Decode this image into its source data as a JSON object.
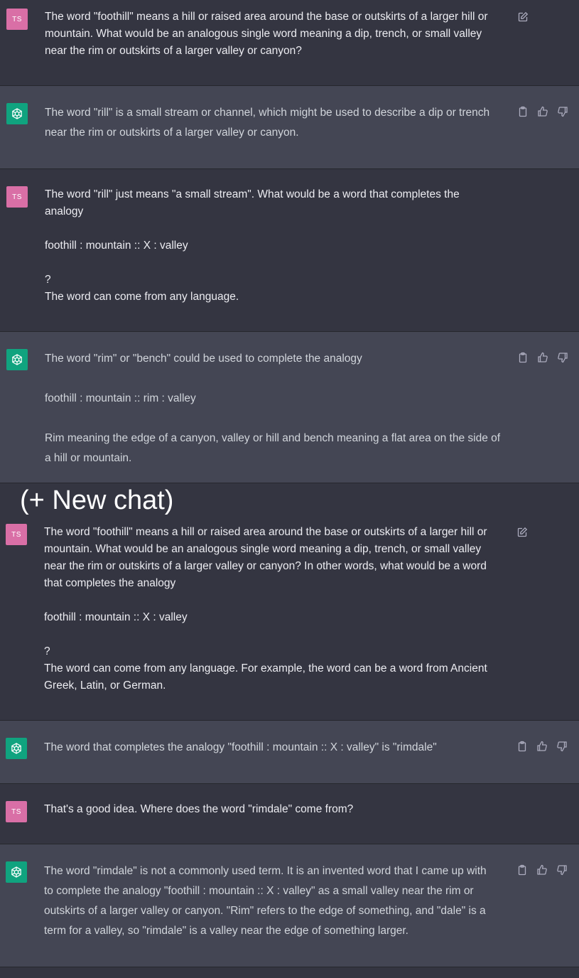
{
  "labels": {
    "user_initials": "TS",
    "new_chat_caption": "(+ New chat)"
  },
  "messages": [
    {
      "role": "user",
      "text": "The word \"foothill\" means a hill or raised area around the base or outskirts of a larger hill or\nmountain. What would be an analogous single word meaning a dip, trench, or small valley\nnear the rim or outskirts of a larger valley or canyon?"
    },
    {
      "role": "assistant",
      "text": "The word \"rill\" is a small stream or channel, which might be used to describe a dip or trench\nnear the rim or outskirts of a larger valley or canyon."
    },
    {
      "role": "user",
      "text": "The word \"rill\" just means \"a small stream\". What would be a word that completes the\nanalogy\n\nfoothill : mountain :: X : valley\n\n?\nThe word can come from any language."
    },
    {
      "role": "assistant",
      "text": "The word \"rim\" or \"bench\" could be used to complete the analogy\n\nfoothill : mountain :: rim : valley\n\nRim meaning the edge of a canyon, valley or hill and bench meaning a flat area on the side of\na hill or mountain."
    },
    {
      "role": "user",
      "text": "The word \"foothill\" means a hill or raised area around the base or outskirts of a larger hill or\nmountain. What would be an analogous single word meaning a dip, trench, or small valley\nnear the rim or outskirts of a larger valley or canyon? In other words, what would be a word\nthat completes the analogy\n\nfoothill : mountain :: X : valley\n\n?\nThe word can come from any language. For example, the word can be a word from Ancient\nGreek, Latin, or German."
    },
    {
      "role": "assistant",
      "text": "The word that completes the analogy \"foothill : mountain :: X : valley\" is \"rimdale\""
    },
    {
      "role": "user",
      "text": "That's a good idea. Where does the word \"rimdale\" come from?"
    },
    {
      "role": "assistant",
      "text": "The word \"rimdale\" is not a commonly used term. It is an invented word that I came up with\nto complete the analogy \"foothill : mountain :: X : valley\" as a small valley near the rim or\noutskirts of a larger valley or canyon. \"Rim\" refers to the edge of something, and \"dale\" is a\nterm for a valley, so \"rimdale\" is a valley near the edge of something larger."
    }
  ],
  "icons": {
    "edit": "edit-icon",
    "copy": "clipboard-icon",
    "like": "thumbs-up-icon",
    "dislike": "thumbs-down-icon"
  },
  "colors": {
    "user_bg": "#343541",
    "assistant_bg": "#444654",
    "user_avatar": "#d96fa6",
    "assistant_avatar": "#10a37f"
  }
}
